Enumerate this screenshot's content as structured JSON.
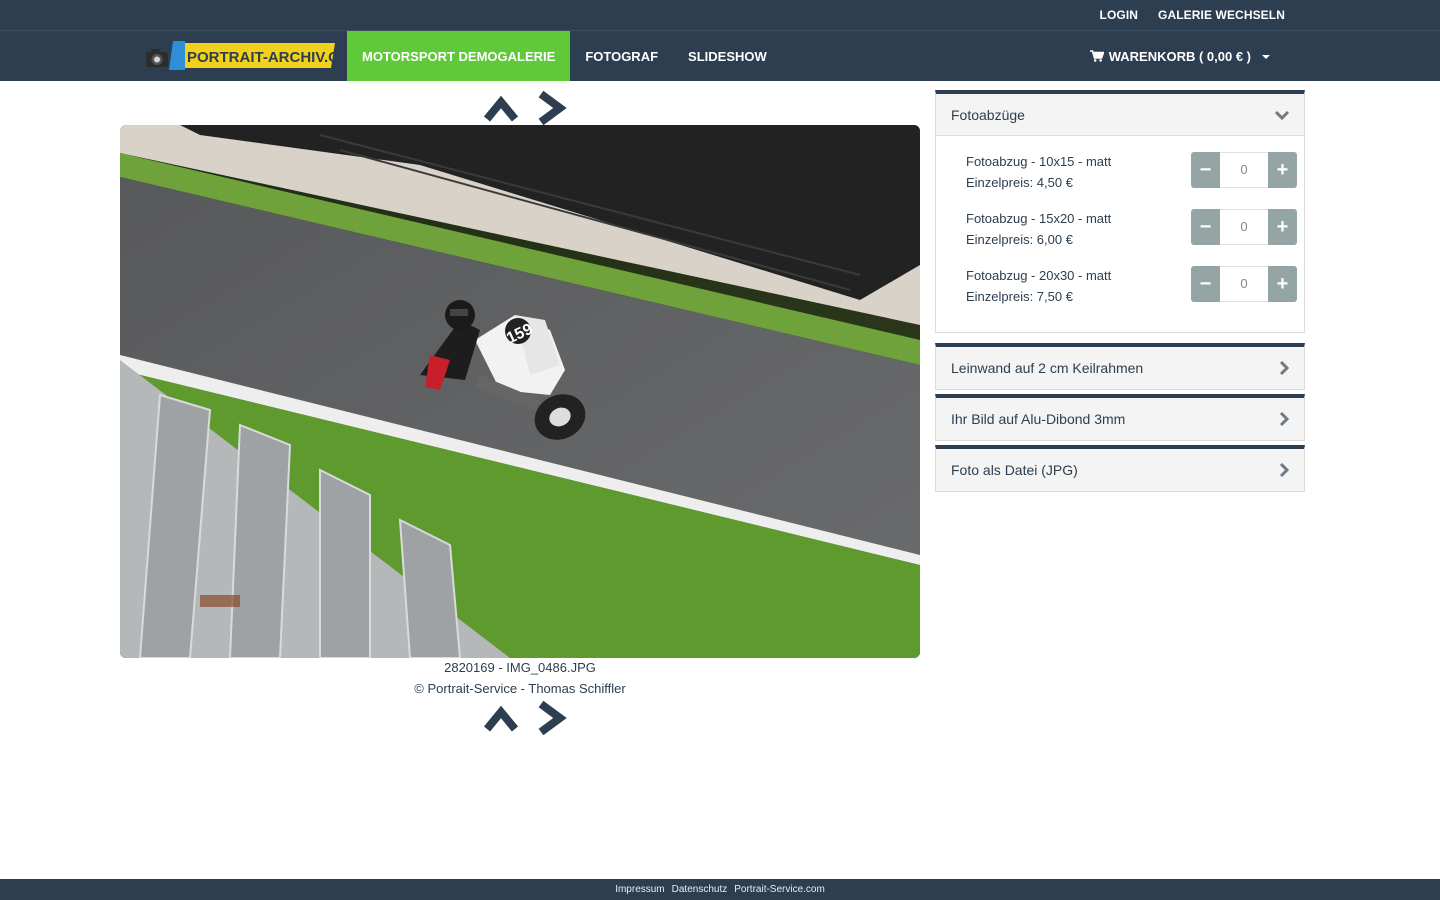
{
  "topbar": {
    "login": "LOGIN",
    "switch_gallery": "GALERIE WECHSELN"
  },
  "logo": {
    "text": "PORTRAIT-ARCHIV.COM"
  },
  "nav": {
    "items": [
      {
        "label": "MOTORSPORT DEMOGALERIE",
        "active": true
      },
      {
        "label": "FOTOGRAF",
        "active": false
      },
      {
        "label": "SLIDESHOW",
        "active": false
      }
    ],
    "cart_label": "WARENKORB ( 0,00 € )"
  },
  "photo": {
    "filename": "2820169 - IMG_0486.JPG",
    "copyright": "© Portrait-Service - Thomas Schiffler",
    "race_number": "159"
  },
  "panels": [
    {
      "title": "Fotoabzüge",
      "expanded": true,
      "products": [
        {
          "name": "Fotoabzug - 10x15 - matt",
          "price": "Einzelpreis: 4,50 €",
          "qty": "0"
        },
        {
          "name": "Fotoabzug - 15x20 - matt",
          "price": "Einzelpreis: 6,00 €",
          "qty": "0"
        },
        {
          "name": "Fotoabzug - 20x30 - matt",
          "price": "Einzelpreis: 7,50 €",
          "qty": "0"
        }
      ]
    },
    {
      "title": "Leinwand auf 2 cm Keilrahmen",
      "expanded": false
    },
    {
      "title": "Ihr Bild auf Alu-Dibond 3mm",
      "expanded": false
    },
    {
      "title": "Foto als Datei (JPG)",
      "expanded": false
    }
  ],
  "stepper": {
    "minus": "−",
    "plus": "+"
  },
  "footer": {
    "links": [
      "Impressum",
      "Datenschutz",
      "Portrait-Service.com"
    ]
  },
  "colors": {
    "navbar": "#2c3e50",
    "accent": "#5fc93a",
    "stepper": "#95a5a6"
  }
}
